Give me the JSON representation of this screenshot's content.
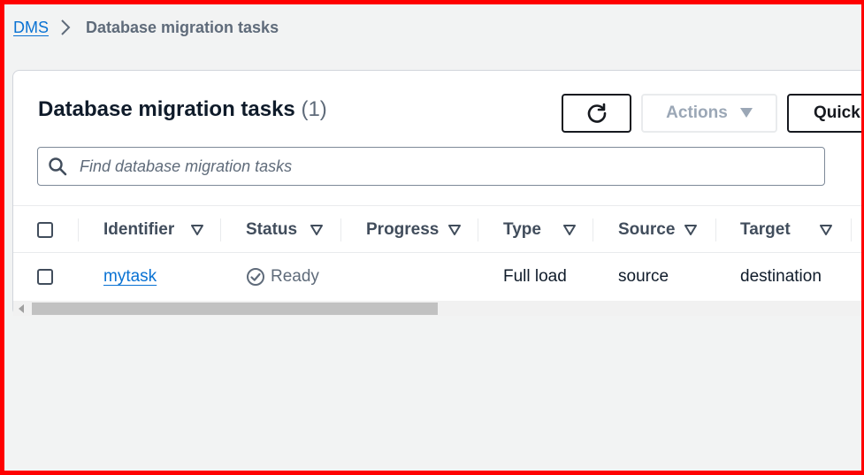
{
  "breadcrumb": {
    "root": "DMS",
    "current": "Database migration tasks"
  },
  "panel": {
    "title": "Database migration tasks",
    "count": "(1)"
  },
  "toolbar": {
    "refresh_icon": "refresh-icon",
    "actions_label": "Actions",
    "quick_label": "Quick"
  },
  "search": {
    "placeholder": "Find database migration tasks",
    "value": ""
  },
  "table": {
    "columns": [
      "Identifier",
      "Status",
      "Progress",
      "Type",
      "Source",
      "Target"
    ],
    "rows": [
      {
        "identifier": "mytask",
        "status": "Ready",
        "progress": "",
        "type": "Full load",
        "source": "source",
        "target": "destination"
      }
    ]
  },
  "colors": {
    "link": "#0972d3",
    "border_frame": "#ff0000",
    "heading": "#0f1b2a",
    "muted": "#5f6b7a"
  }
}
